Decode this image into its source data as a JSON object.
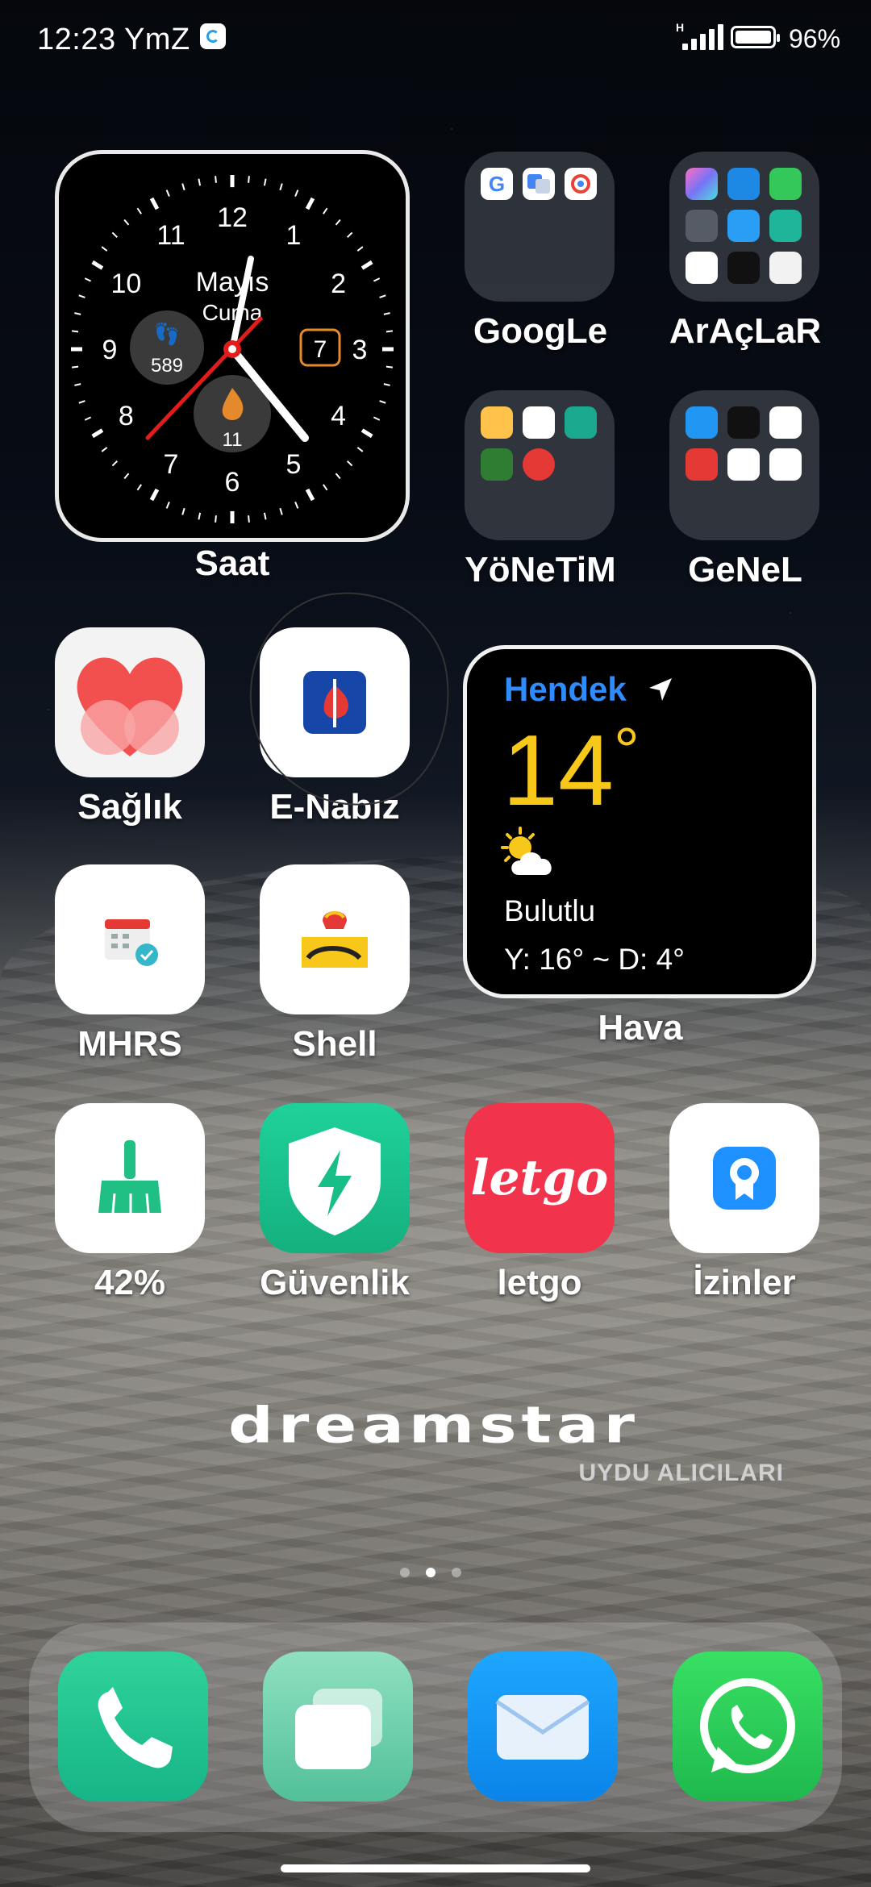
{
  "status_bar": {
    "time": "12:23 YmZ",
    "network": "H",
    "battery": "96%"
  },
  "clock_widget": {
    "label": "Saat",
    "month_line1": "Mayıs",
    "month_line2": "Cuma",
    "date_box": "7",
    "steps": "589",
    "calories": "11",
    "hour_numbers": [
      "12",
      "1",
      "2",
      "3",
      "4",
      "5",
      "6",
      "7",
      "8",
      "9",
      "10",
      "11"
    ],
    "time_shown": "12:23",
    "accent": "#e21b1b"
  },
  "folders": [
    {
      "name": "GoogLe"
    },
    {
      "name": "ArAçLaR"
    },
    {
      "name": "YöNeTiM"
    },
    {
      "name": "GeNeL"
    }
  ],
  "apps_row1": [
    {
      "name": "Sağlık",
      "icon": "heart-icon"
    },
    {
      "name": "E-Nabız",
      "icon": "e-nabiz-icon"
    }
  ],
  "apps_row2": [
    {
      "name": "MHRS",
      "icon": "calendar-check-icon"
    },
    {
      "name": "Shell",
      "icon": "shell-logo-icon"
    }
  ],
  "apps_row3": [
    {
      "name": "42%",
      "icon": "broom-icon"
    },
    {
      "name": "Güvenlik",
      "icon": "shield-bolt-icon"
    },
    {
      "name": "letgo",
      "icon": "letgo-logo",
      "logo_text": "letgo"
    },
    {
      "name": "İzinler",
      "icon": "badge-icon"
    }
  ],
  "weather": {
    "city": "Hendek",
    "temperature": "14",
    "degree": "°",
    "condition": "Bulutlu",
    "range": "Y: 16° ~ D: 4°",
    "label": "Hava",
    "city_color": "#2f8cff",
    "temp_color": "#f7c81a"
  },
  "branding": {
    "title": "dreamstar",
    "subtitle": "UYDU ALICILARI"
  },
  "page_indicator": {
    "pages": 3,
    "current": 2
  },
  "dock": [
    {
      "icon": "phone-icon"
    },
    {
      "icon": "messages-icon"
    },
    {
      "icon": "mail-icon"
    },
    {
      "icon": "whatsapp-icon"
    }
  ]
}
